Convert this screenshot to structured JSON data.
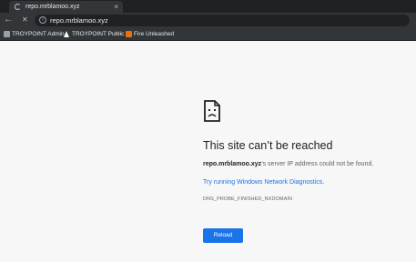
{
  "browser": {
    "tab_title": "repo.mrblamoo.xyz",
    "tab_close": "×",
    "back_icon": "←",
    "stop_icon": "✕",
    "url": "repo.mrblamoo.xyz",
    "info_icon": "i"
  },
  "bookmarks": [
    {
      "label": "TROYPOINT Admin",
      "icon": "folder-icon"
    },
    {
      "label": "TROYPOINT Public",
      "icon": "triangle-icon"
    },
    {
      "label": "Fire Unleashed",
      "icon": "fire-icon"
    }
  ],
  "error": {
    "title": "This site can’t be reached",
    "host": "repo.mrblamoo.xyz",
    "message_rest": "’s server IP address could not be found.",
    "suggestion_link": "Try running Windows Network Diagnostics",
    "suggestion_end": ".",
    "code": "DNS_PROBE_FINISHED_NXDOMAIN",
    "reload_label": "Reload"
  },
  "colors": {
    "accent": "#1a73e8",
    "chrome_dark": "#323639",
    "page_bg": "#f7f7f7"
  }
}
